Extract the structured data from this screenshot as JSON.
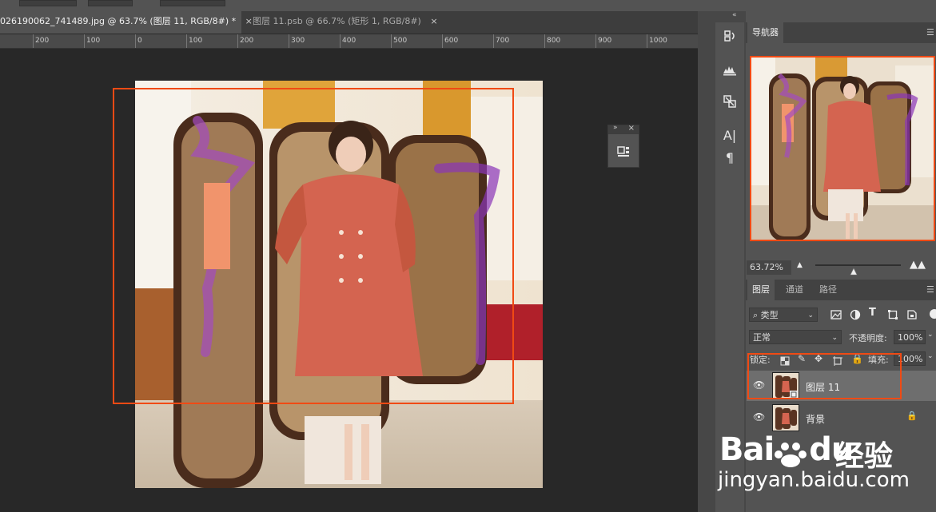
{
  "document_tabs": [
    {
      "label": "026190062_741489.jpg @ 63.7% (图层 11, RGB/8#) *",
      "close": "×",
      "active": true
    },
    {
      "label": "图层 11.psb @ 66.7% (矩形 1, RGB/8#)",
      "close": "×",
      "active": false
    }
  ],
  "ruler": {
    "labels": [
      "200",
      "100",
      "0",
      "100",
      "200",
      "300",
      "400",
      "500",
      "600",
      "700",
      "800",
      "900",
      "1000"
    ]
  },
  "navigator": {
    "tab_label": "导航器",
    "zoom": "63.72%"
  },
  "layers_panel": {
    "tabs": [
      "图层",
      "通道",
      "路径"
    ],
    "filter_kind": "类型",
    "blend_mode": "正常",
    "opacity_label": "不透明度:",
    "opacity_value": "100%",
    "lock_label": "锁定:",
    "fill_label": "填充:",
    "fill_value": "100%",
    "layers": [
      {
        "name": "图层 11",
        "visible": true,
        "selected": true
      },
      {
        "name": "背景",
        "visible": true,
        "selected": false,
        "locked": true
      }
    ]
  },
  "watermark": {
    "brand": "Bai",
    "brand2": "du",
    "brand_cn": "经验",
    "url": "jingyan.baidu.com"
  },
  "colors": {
    "highlight": "#f04a14",
    "panel_bg": "#535353",
    "canvas_bg": "#282828"
  }
}
